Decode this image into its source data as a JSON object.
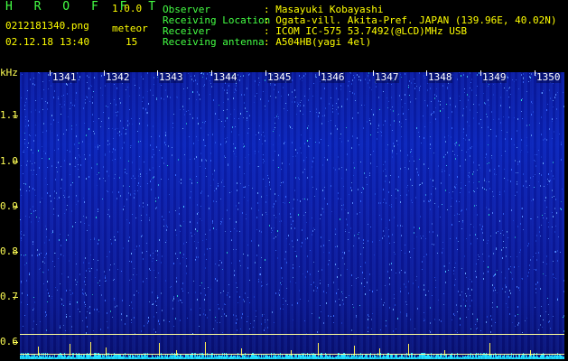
{
  "app": {
    "name": "H R O F F T",
    "version": "1.0.0"
  },
  "file": {
    "name": "0212181340.png",
    "date": "02.12.18",
    "time": "13:40"
  },
  "counter": {
    "label": "meteor",
    "value": "15"
  },
  "info": [
    {
      "label": "Observer",
      "value": ": Masayuki Kobayashi"
    },
    {
      "label": "Receiving Location",
      "value": ": Ogata-vill. Akita-Pref. JAPAN (139.96E, 40.02N)"
    },
    {
      "label": "Receiver",
      "value": ": ICOM IC-575 53.7492(@LCD)MHz USB"
    },
    {
      "label": "Receiving antenna",
      "value": ": A504HB(yagi 4el)"
    }
  ],
  "axis": {
    "y_unit": "kHz",
    "y_ticks": [
      "1.1",
      "1.0",
      "0.9",
      "0.8",
      "0.7",
      "0.6"
    ],
    "x_ticks": [
      "1341",
      "1342",
      "1343",
      "1344",
      "1345",
      "1346",
      "1347",
      "1348",
      "1349",
      "1350"
    ]
  },
  "colors": {
    "header_text": "#44ff44",
    "value_text": "#ffff00",
    "background": "#000000",
    "spectrum": "#0a1aa0"
  }
}
